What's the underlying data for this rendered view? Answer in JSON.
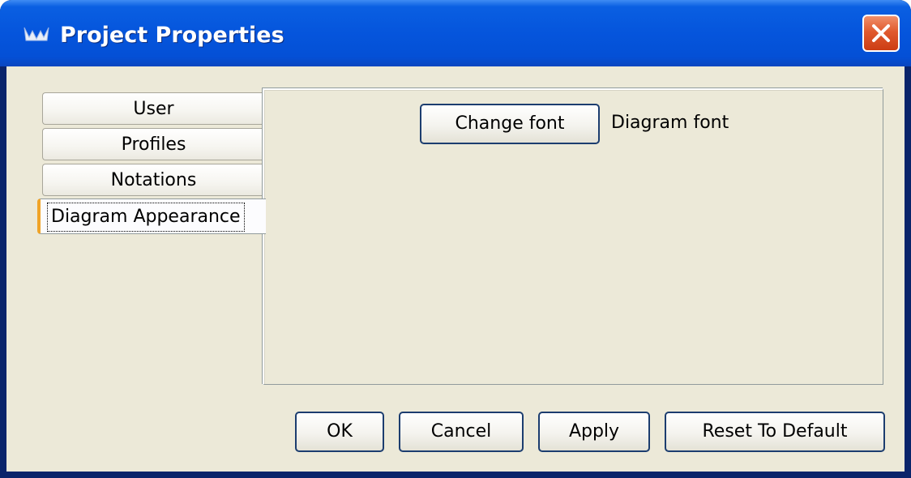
{
  "window": {
    "title": "Project Properties",
    "app_icon": "argouml-app-icon",
    "close_icon": "close-icon"
  },
  "tabs": [
    {
      "label": "User",
      "selected": false
    },
    {
      "label": "Profiles",
      "selected": false
    },
    {
      "label": "Notations",
      "selected": false
    },
    {
      "label": "Diagram Appearance",
      "selected": true
    }
  ],
  "panel": {
    "change_font_button": "Change font",
    "font_label": "Diagram font"
  },
  "footer": {
    "ok": "OK",
    "cancel": "Cancel",
    "apply": "Apply",
    "reset": "Reset To Default"
  },
  "colors": {
    "titlebar": "#0555dc",
    "close_button": "#e05a2e",
    "dialog_bg": "#ece9d8",
    "selected_tab_accent": "#f0a428",
    "button_border": "#1c3d6f"
  }
}
